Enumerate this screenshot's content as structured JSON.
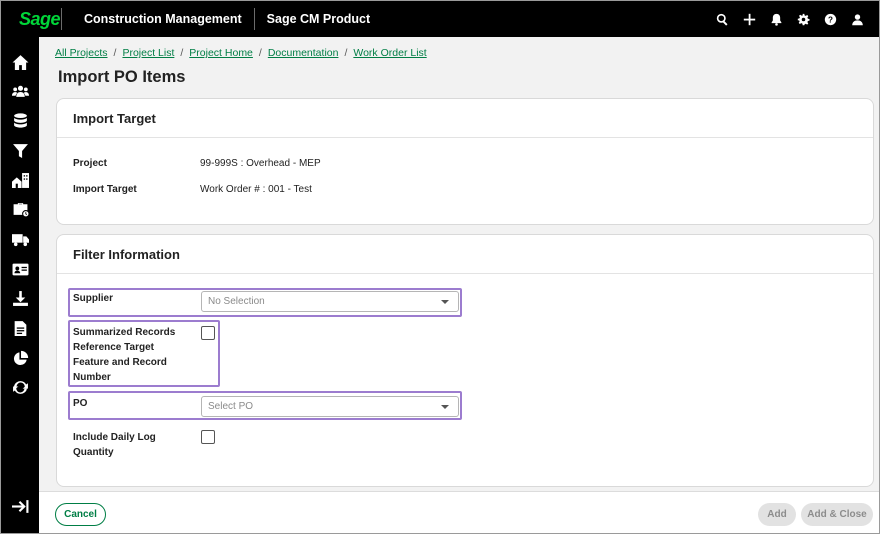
{
  "topbar": {
    "logo": "Sage",
    "app_title": "Construction Management",
    "product_name": "Sage CM Product",
    "icons": [
      "search-icon",
      "plus-icon",
      "bell-icon",
      "gear-icon",
      "help-icon",
      "user-icon"
    ]
  },
  "sidebar": {
    "items": [
      "home-icon",
      "people-icon",
      "stack-icon",
      "filter-icon",
      "buildings-icon",
      "briefcase-icon",
      "truck-icon",
      "id-card-icon",
      "download-icon",
      "document-icon",
      "pie-chart-icon",
      "sync-icon"
    ],
    "collapse_icon": "expand-arrow-icon"
  },
  "breadcrumb": [
    "All Projects",
    "Project List",
    "Project Home",
    "Documentation",
    "Work Order List"
  ],
  "page_title": "Import PO Items",
  "import_target": {
    "header": "Import Target",
    "project_label": "Project",
    "project_value": "99-999S : Overhead - MEP",
    "target_label": "Import Target",
    "target_value": "Work Order # : 001 - Test"
  },
  "filter": {
    "header": "Filter Information",
    "supplier_label": "Supplier",
    "supplier_value": "No Selection",
    "summarized_label_1": "Summarized Records",
    "summarized_label_2": "Reference Target",
    "summarized_label_3": "Feature and Record",
    "summarized_label_4": "Number",
    "po_label": "PO",
    "po_value": "Select PO",
    "daily_log_label_1": "Include Daily Log",
    "daily_log_label_2": "Quantity"
  },
  "footer": {
    "cancel_label": "Cancel",
    "add_label": "Add",
    "add_close_label": "Add & Close"
  },
  "colors": {
    "brand_green": "#007e45",
    "logo_green": "#00d639",
    "highlight": "#9c7ccf"
  }
}
